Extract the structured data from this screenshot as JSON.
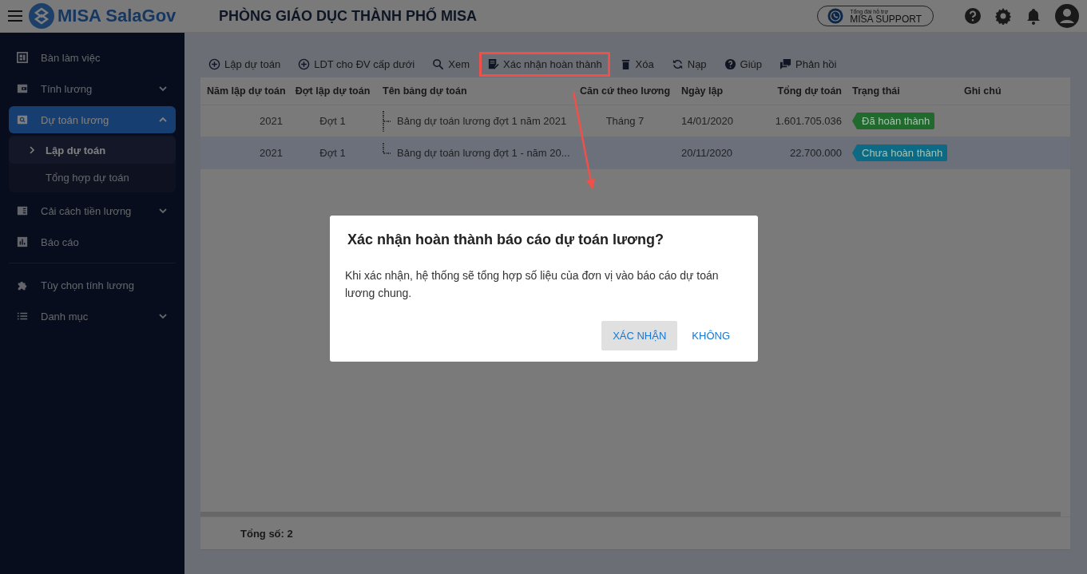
{
  "header": {
    "logo_text": "MISA SalaGov",
    "title": "PHÒNG GIÁO DỤC THÀNH PHỐ MISA",
    "support": {
      "caption": "Tổng đài hỗ trợ",
      "label": "MISA SUPPORT"
    }
  },
  "sidebar": {
    "sections": [
      {
        "items": [
          {
            "label": "Bàn làm việc",
            "selected": false
          },
          {
            "label": "Tính lương",
            "selected": false,
            "expanded": false
          },
          {
            "label": "Dự toán lương",
            "selected": true,
            "expanded": true,
            "children": [
              {
                "label": "Lập dự toán",
                "selected": true
              },
              {
                "label": "Tổng hợp dự toán",
                "selected": false
              }
            ]
          },
          {
            "label": "Cải cách tiền lương",
            "selected": false,
            "expanded": false
          },
          {
            "label": "Báo cáo",
            "selected": false
          }
        ]
      },
      {
        "items": [
          {
            "label": "Tùy chọn tính lương",
            "selected": false
          },
          {
            "label": "Danh mục",
            "selected": false,
            "expanded": false
          }
        ]
      }
    ]
  },
  "toolbar": [
    {
      "label": "Lập dự toán",
      "highlighted": false
    },
    {
      "label": "LDT cho ĐV cấp dưới",
      "highlighted": false
    },
    {
      "label": "Xem",
      "highlighted": false
    },
    {
      "label": "Xác nhận hoàn thành",
      "highlighted": true
    },
    {
      "label": "Xóa",
      "highlighted": false
    },
    {
      "label": "Nạp",
      "highlighted": false
    },
    {
      "label": "Giúp",
      "highlighted": false
    },
    {
      "label": "Phản hồi",
      "highlighted": false
    }
  ],
  "table": {
    "columns": [
      "Năm lập dự toán",
      "Đợt lập dự toán",
      "Tên bảng dự toán",
      "Căn cứ theo lương",
      "Ngày lập",
      "Tổng dự toán",
      "Trạng thái",
      "Ghi chú"
    ],
    "rows": [
      {
        "selected": false,
        "cells": [
          "2021",
          "Đợt 1",
          "Bảng dự toán lương đợt 1 năm 2021",
          "Tháng 7",
          "14/01/2020",
          "1.601.705.036"
        ],
        "status": {
          "label": "Đã hoàn thành",
          "color": "#216a2e"
        }
      },
      {
        "selected": true,
        "cells": [
          "2021",
          "Đợt 1",
          "Bảng dự toán lương đợt 1 - năm 20...",
          "",
          "20/11/2020",
          "22.700.000"
        ],
        "status": {
          "label": "Chưa hoàn thành",
          "color": "#0c6a85"
        }
      }
    ]
  },
  "footer": {
    "total": "Tổng số: 2"
  },
  "dialog": {
    "title": "Xác nhận hoàn thành báo cáo dự toán lương?",
    "message": "Khi xác nhận, hệ thống sẽ tổng hợp số liệu của đơn vị vào báo cáo dự toán lương chung.",
    "buttons": [
      {
        "label": "XÁC NHẬN",
        "kind": "primary"
      },
      {
        "label": "KHÔNG",
        "kind": "text"
      }
    ]
  }
}
